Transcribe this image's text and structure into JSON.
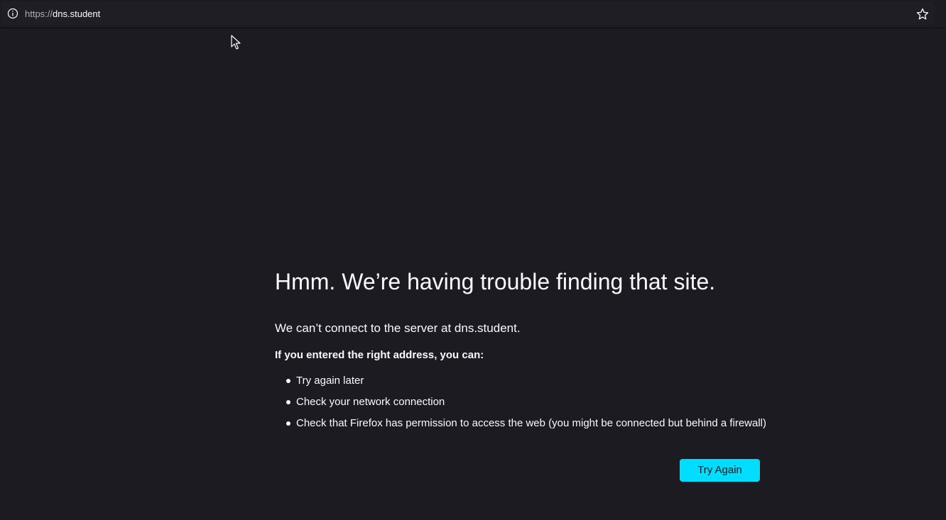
{
  "address_bar": {
    "url_scheme": "https://",
    "url_host": "dns.student",
    "info_icon": "info-icon",
    "bookmark_icon": "star-icon"
  },
  "error_page": {
    "title": "Hmm. We’re having trouble finding that site.",
    "short_description": "We can’t connect to the server at dns.student.",
    "advice_heading": "If you entered the right address, you can:",
    "advice_items": [
      "Try again later",
      "Check your network connection",
      "Check that Firefox has permission to access the web (you might be connected but behind a firewall)"
    ],
    "try_again_label": "Try Again"
  },
  "colors": {
    "background": "#1c1b22",
    "accent_button": "#00ddff",
    "text": "#fbfbfe"
  }
}
